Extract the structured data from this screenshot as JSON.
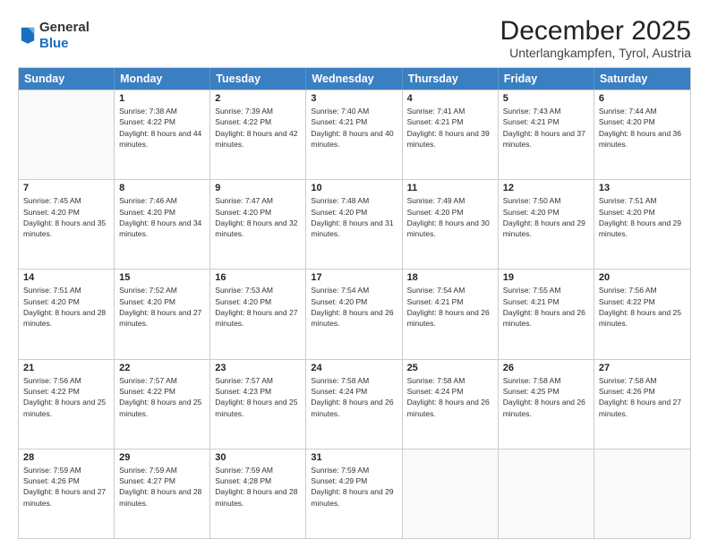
{
  "logo": {
    "general": "General",
    "blue": "Blue"
  },
  "title": "December 2025",
  "subtitle": "Unterlangkampfen, Tyrol, Austria",
  "days": [
    "Sunday",
    "Monday",
    "Tuesday",
    "Wednesday",
    "Thursday",
    "Friday",
    "Saturday"
  ],
  "weeks": [
    [
      {
        "date": "",
        "sunrise": "",
        "sunset": "",
        "daylight": ""
      },
      {
        "date": "1",
        "sunrise": "Sunrise: 7:38 AM",
        "sunset": "Sunset: 4:22 PM",
        "daylight": "Daylight: 8 hours and 44 minutes."
      },
      {
        "date": "2",
        "sunrise": "Sunrise: 7:39 AM",
        "sunset": "Sunset: 4:22 PM",
        "daylight": "Daylight: 8 hours and 42 minutes."
      },
      {
        "date": "3",
        "sunrise": "Sunrise: 7:40 AM",
        "sunset": "Sunset: 4:21 PM",
        "daylight": "Daylight: 8 hours and 40 minutes."
      },
      {
        "date": "4",
        "sunrise": "Sunrise: 7:41 AM",
        "sunset": "Sunset: 4:21 PM",
        "daylight": "Daylight: 8 hours and 39 minutes."
      },
      {
        "date": "5",
        "sunrise": "Sunrise: 7:43 AM",
        "sunset": "Sunset: 4:21 PM",
        "daylight": "Daylight: 8 hours and 37 minutes."
      },
      {
        "date": "6",
        "sunrise": "Sunrise: 7:44 AM",
        "sunset": "Sunset: 4:20 PM",
        "daylight": "Daylight: 8 hours and 36 minutes."
      }
    ],
    [
      {
        "date": "7",
        "sunrise": "Sunrise: 7:45 AM",
        "sunset": "Sunset: 4:20 PM",
        "daylight": "Daylight: 8 hours and 35 minutes."
      },
      {
        "date": "8",
        "sunrise": "Sunrise: 7:46 AM",
        "sunset": "Sunset: 4:20 PM",
        "daylight": "Daylight: 8 hours and 34 minutes."
      },
      {
        "date": "9",
        "sunrise": "Sunrise: 7:47 AM",
        "sunset": "Sunset: 4:20 PM",
        "daylight": "Daylight: 8 hours and 32 minutes."
      },
      {
        "date": "10",
        "sunrise": "Sunrise: 7:48 AM",
        "sunset": "Sunset: 4:20 PM",
        "daylight": "Daylight: 8 hours and 31 minutes."
      },
      {
        "date": "11",
        "sunrise": "Sunrise: 7:49 AM",
        "sunset": "Sunset: 4:20 PM",
        "daylight": "Daylight: 8 hours and 30 minutes."
      },
      {
        "date": "12",
        "sunrise": "Sunrise: 7:50 AM",
        "sunset": "Sunset: 4:20 PM",
        "daylight": "Daylight: 8 hours and 29 minutes."
      },
      {
        "date": "13",
        "sunrise": "Sunrise: 7:51 AM",
        "sunset": "Sunset: 4:20 PM",
        "daylight": "Daylight: 8 hours and 29 minutes."
      }
    ],
    [
      {
        "date": "14",
        "sunrise": "Sunrise: 7:51 AM",
        "sunset": "Sunset: 4:20 PM",
        "daylight": "Daylight: 8 hours and 28 minutes."
      },
      {
        "date": "15",
        "sunrise": "Sunrise: 7:52 AM",
        "sunset": "Sunset: 4:20 PM",
        "daylight": "Daylight: 8 hours and 27 minutes."
      },
      {
        "date": "16",
        "sunrise": "Sunrise: 7:53 AM",
        "sunset": "Sunset: 4:20 PM",
        "daylight": "Daylight: 8 hours and 27 minutes."
      },
      {
        "date": "17",
        "sunrise": "Sunrise: 7:54 AM",
        "sunset": "Sunset: 4:20 PM",
        "daylight": "Daylight: 8 hours and 26 minutes."
      },
      {
        "date": "18",
        "sunrise": "Sunrise: 7:54 AM",
        "sunset": "Sunset: 4:21 PM",
        "daylight": "Daylight: 8 hours and 26 minutes."
      },
      {
        "date": "19",
        "sunrise": "Sunrise: 7:55 AM",
        "sunset": "Sunset: 4:21 PM",
        "daylight": "Daylight: 8 hours and 26 minutes."
      },
      {
        "date": "20",
        "sunrise": "Sunrise: 7:56 AM",
        "sunset": "Sunset: 4:22 PM",
        "daylight": "Daylight: 8 hours and 25 minutes."
      }
    ],
    [
      {
        "date": "21",
        "sunrise": "Sunrise: 7:56 AM",
        "sunset": "Sunset: 4:22 PM",
        "daylight": "Daylight: 8 hours and 25 minutes."
      },
      {
        "date": "22",
        "sunrise": "Sunrise: 7:57 AM",
        "sunset": "Sunset: 4:22 PM",
        "daylight": "Daylight: 8 hours and 25 minutes."
      },
      {
        "date": "23",
        "sunrise": "Sunrise: 7:57 AM",
        "sunset": "Sunset: 4:23 PM",
        "daylight": "Daylight: 8 hours and 25 minutes."
      },
      {
        "date": "24",
        "sunrise": "Sunrise: 7:58 AM",
        "sunset": "Sunset: 4:24 PM",
        "daylight": "Daylight: 8 hours and 26 minutes."
      },
      {
        "date": "25",
        "sunrise": "Sunrise: 7:58 AM",
        "sunset": "Sunset: 4:24 PM",
        "daylight": "Daylight: 8 hours and 26 minutes."
      },
      {
        "date": "26",
        "sunrise": "Sunrise: 7:58 AM",
        "sunset": "Sunset: 4:25 PM",
        "daylight": "Daylight: 8 hours and 26 minutes."
      },
      {
        "date": "27",
        "sunrise": "Sunrise: 7:58 AM",
        "sunset": "Sunset: 4:26 PM",
        "daylight": "Daylight: 8 hours and 27 minutes."
      }
    ],
    [
      {
        "date": "28",
        "sunrise": "Sunrise: 7:59 AM",
        "sunset": "Sunset: 4:26 PM",
        "daylight": "Daylight: 8 hours and 27 minutes."
      },
      {
        "date": "29",
        "sunrise": "Sunrise: 7:59 AM",
        "sunset": "Sunset: 4:27 PM",
        "daylight": "Daylight: 8 hours and 28 minutes."
      },
      {
        "date": "30",
        "sunrise": "Sunrise: 7:59 AM",
        "sunset": "Sunset: 4:28 PM",
        "daylight": "Daylight: 8 hours and 28 minutes."
      },
      {
        "date": "31",
        "sunrise": "Sunrise: 7:59 AM",
        "sunset": "Sunset: 4:29 PM",
        "daylight": "Daylight: 8 hours and 29 minutes."
      },
      {
        "date": "",
        "sunrise": "",
        "sunset": "",
        "daylight": ""
      },
      {
        "date": "",
        "sunrise": "",
        "sunset": "",
        "daylight": ""
      },
      {
        "date": "",
        "sunrise": "",
        "sunset": "",
        "daylight": ""
      }
    ]
  ]
}
